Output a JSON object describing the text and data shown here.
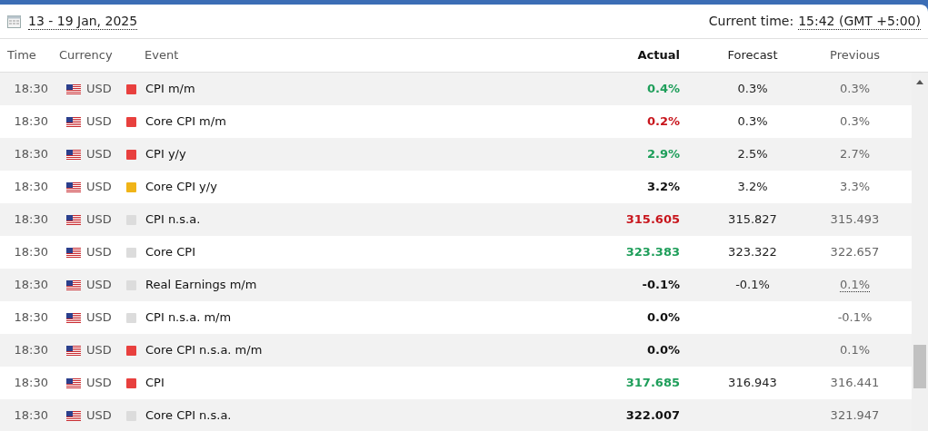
{
  "header": {
    "date_range": "13 - 19 Jan, 2025",
    "current_time_label": "Current time:",
    "current_time": "15:42 (GMT +5:00)"
  },
  "table": {
    "columns": [
      "Time",
      "Currency",
      "Event",
      "Actual",
      "Forecast",
      "Previous"
    ],
    "rows": [
      {
        "time": "18:30",
        "currency": "USD",
        "color": "#e8403e",
        "event": "CPI m/m",
        "actual": {
          "value": "0.4%",
          "color": "#1e9e5a"
        },
        "forecast": "0.3%",
        "previous": "0.3%",
        "previous_revised": false
      },
      {
        "time": "18:30",
        "currency": "USD",
        "color": "#e8403e",
        "event": "Core CPI m/m",
        "actual": {
          "value": "0.2%",
          "color": "#c8161d"
        },
        "forecast": "0.3%",
        "previous": "0.3%",
        "previous_revised": false
      },
      {
        "time": "18:30",
        "currency": "USD",
        "color": "#e8403e",
        "event": "CPI y/y",
        "actual": {
          "value": "2.9%",
          "color": "#1e9e5a"
        },
        "forecast": "2.5%",
        "previous": "2.7%",
        "previous_revised": false
      },
      {
        "time": "18:30",
        "currency": "USD",
        "color": "#f0b418",
        "event": "Core CPI y/y",
        "actual": {
          "value": "3.2%",
          "color": "#111111"
        },
        "forecast": "3.2%",
        "previous": "3.3%",
        "previous_revised": false
      },
      {
        "time": "18:30",
        "currency": "USD",
        "color": "#dcdcdc",
        "event": "CPI n.s.a.",
        "actual": {
          "value": "315.605",
          "color": "#c8161d"
        },
        "forecast": "315.827",
        "previous": "315.493",
        "previous_revised": false
      },
      {
        "time": "18:30",
        "currency": "USD",
        "color": "#dcdcdc",
        "event": "Core CPI",
        "actual": {
          "value": "323.383",
          "color": "#1e9e5a"
        },
        "forecast": "323.322",
        "previous": "322.657",
        "previous_revised": false
      },
      {
        "time": "18:30",
        "currency": "USD",
        "color": "#dcdcdc",
        "event": "Real Earnings m/m",
        "actual": {
          "value": "-0.1%",
          "color": "#111111"
        },
        "forecast": "-0.1%",
        "previous": "0.1%",
        "previous_revised": true
      },
      {
        "time": "18:30",
        "currency": "USD",
        "color": "#dcdcdc",
        "event": "CPI n.s.a. m/m",
        "actual": {
          "value": "0.0%",
          "color": "#111111"
        },
        "previous": "-0.1%",
        "previous_revised": false
      },
      {
        "time": "18:30",
        "currency": "USD",
        "color": "#e8403e",
        "event": "Core CPI n.s.a. m/m",
        "actual": {
          "value": "0.0%",
          "color": "#111111"
        },
        "previous": "0.1%",
        "previous_revised": false
      },
      {
        "time": "18:30",
        "currency": "USD",
        "color": "#e8403e",
        "event": "CPI",
        "actual": {
          "value": "317.685",
          "color": "#1e9e5a"
        },
        "forecast": "316.943",
        "previous": "316.441",
        "previous_revised": false
      },
      {
        "time": "18:30",
        "currency": "USD",
        "color": "#dcdcdc",
        "event": "Core CPI n.s.a.",
        "actual": {
          "value": "322.007",
          "color": "#111111"
        },
        "previous": "321.947",
        "previous_revised": false
      }
    ]
  }
}
